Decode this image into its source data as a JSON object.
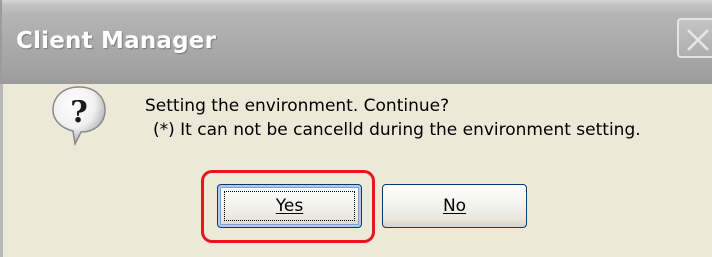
{
  "window": {
    "title": "Client Manager",
    "close_icon": "close-x-icon"
  },
  "message": {
    "icon": "question-icon",
    "line1": "Setting the environment. Continue?",
    "line2": "(*) It can not be cancelld during the environment setting."
  },
  "buttons": {
    "yes_label": "Yes",
    "no_label": "No"
  },
  "colors": {
    "highlight": "#e8141e",
    "dialog_bg": "#ece9d8",
    "button_border": "#003c74"
  }
}
